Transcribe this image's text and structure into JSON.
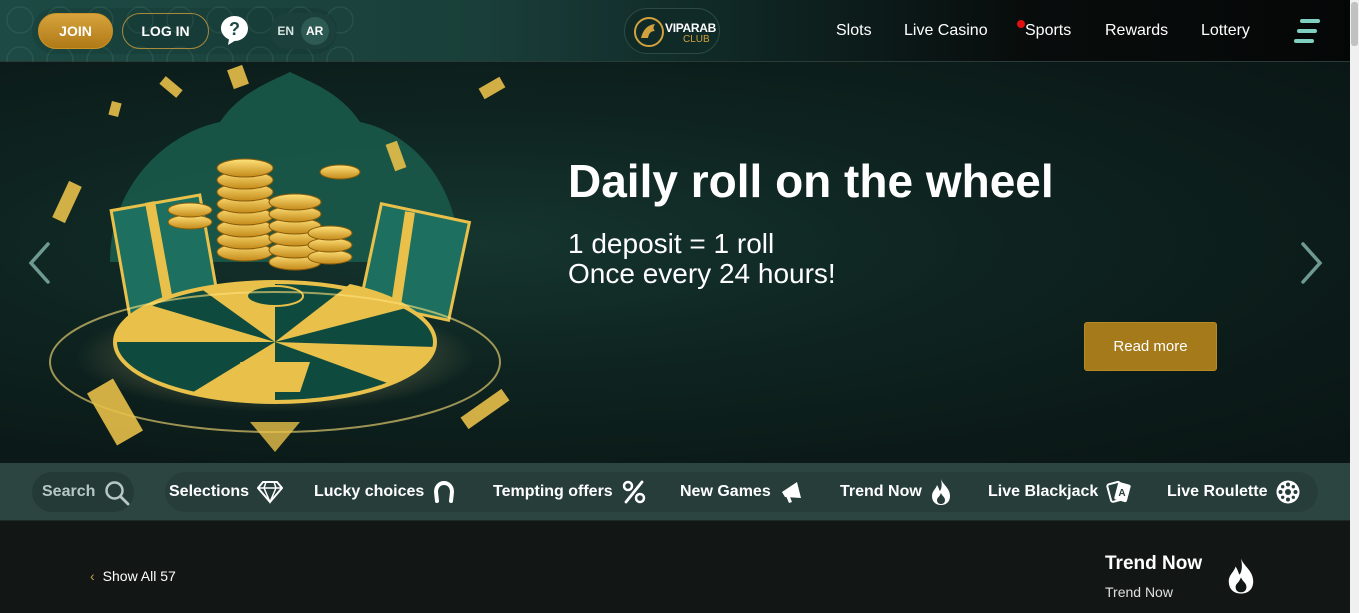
{
  "header": {
    "join_label": "JOIN",
    "login_label": "LOG IN",
    "help_icon": "question-circle-icon",
    "lang_en": "EN",
    "lang_ar": "AR",
    "logo_title": "VIPARAB",
    "logo_sub": "CLUB",
    "nav": [
      "Slots",
      "Live Casino",
      "Sports",
      "Rewards",
      "Lottery"
    ],
    "menu_icon": "hamburger-menu-icon"
  },
  "hero": {
    "title": "Daily roll on the wheel",
    "line1": "1 deposit = 1 roll",
    "line2": "Once every 24 hours!",
    "cta": "Read more"
  },
  "categories": {
    "search_label": "Search",
    "items": [
      {
        "label": "Selections",
        "icon": "diamond-icon"
      },
      {
        "label": "Lucky choices",
        "icon": "horseshoe-icon"
      },
      {
        "label": "Tempting offers",
        "icon": "percent-icon"
      },
      {
        "label": "New Games",
        "icon": "megaphone-icon"
      },
      {
        "label": "Trend Now",
        "icon": "flame-icon"
      },
      {
        "label": "Live Blackjack",
        "icon": "cards-icon"
      },
      {
        "label": "Live Roulette",
        "icon": "roulette-icon"
      }
    ]
  },
  "section": {
    "show_all": "Show All 57",
    "title": "Trend Now",
    "subtitle": "Trend Now"
  },
  "colors": {
    "gold": "#b07a17",
    "teal_bar": "#2c4541",
    "hero_bg": "#0e2420",
    "sports_dot": "#e01010"
  }
}
